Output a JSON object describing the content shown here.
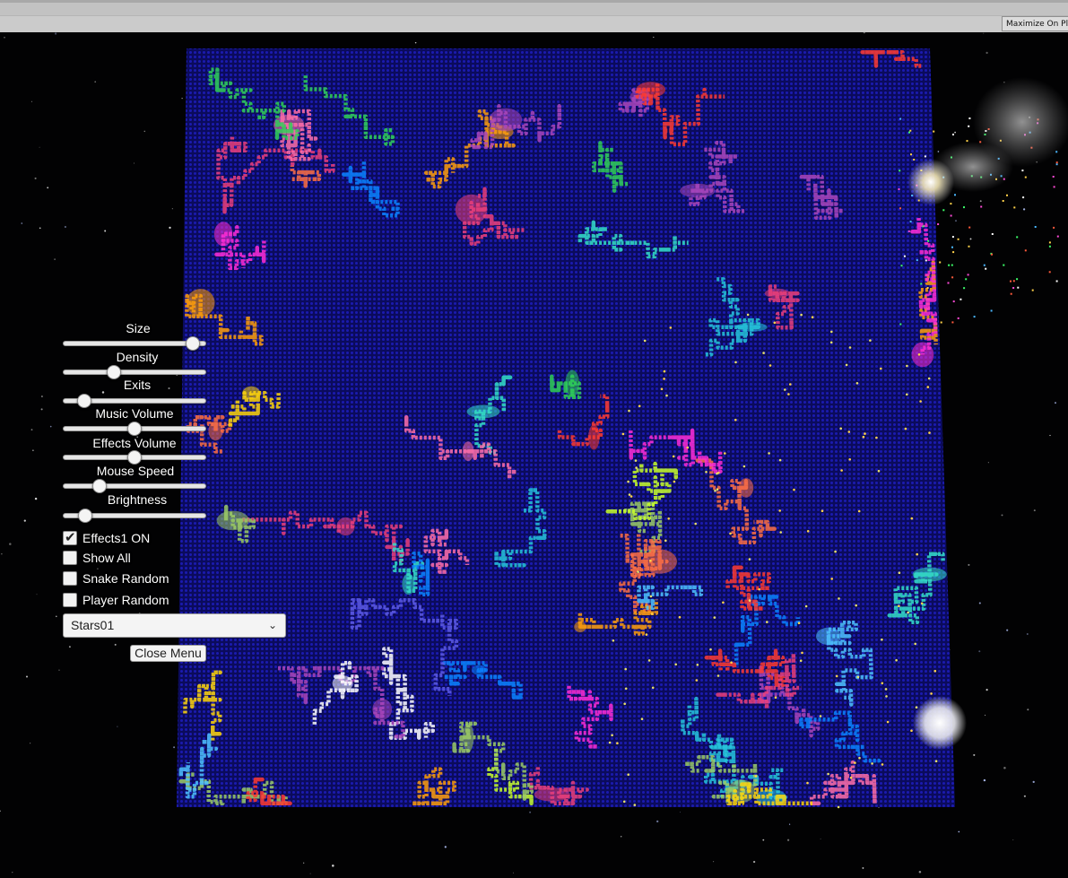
{
  "editor": {
    "maximize_label": "Maximize On Play"
  },
  "game": {
    "board_color": "#0a0a8a",
    "path_colors": [
      "#ff3b30",
      "#ff9f0a",
      "#ffd60a",
      "#c8ff2a",
      "#30d158",
      "#34e0c8",
      "#4fc3ff",
      "#0a84ff",
      "#5e5ce6",
      "#bf5af2",
      "#ff2dd6",
      "#ff6fa8",
      "#ffffff",
      "#ff7043",
      "#9ccc65",
      "#26c6da",
      "#ab47bc",
      "#ec407a"
    ]
  },
  "menu": {
    "sliders": [
      {
        "label": "Size",
        "value": 0.95
      },
      {
        "label": "Density",
        "value": 0.34
      },
      {
        "label": "Exits",
        "value": 0.11
      },
      {
        "label": "Music Volume",
        "value": 0.5
      },
      {
        "label": "Effects Volume",
        "value": 0.5
      },
      {
        "label": "Mouse Speed",
        "value": 0.23
      },
      {
        "label": "Brightness",
        "value": 0.12
      }
    ],
    "toggles": [
      {
        "label": "Effects1 ON",
        "checked": true
      },
      {
        "label": "Show All",
        "checked": false
      },
      {
        "label": "Snake Random",
        "checked": false
      },
      {
        "label": "Player Random",
        "checked": false
      }
    ],
    "dropdown": {
      "selected": "Stars01"
    },
    "close_label": "Close Menu"
  }
}
